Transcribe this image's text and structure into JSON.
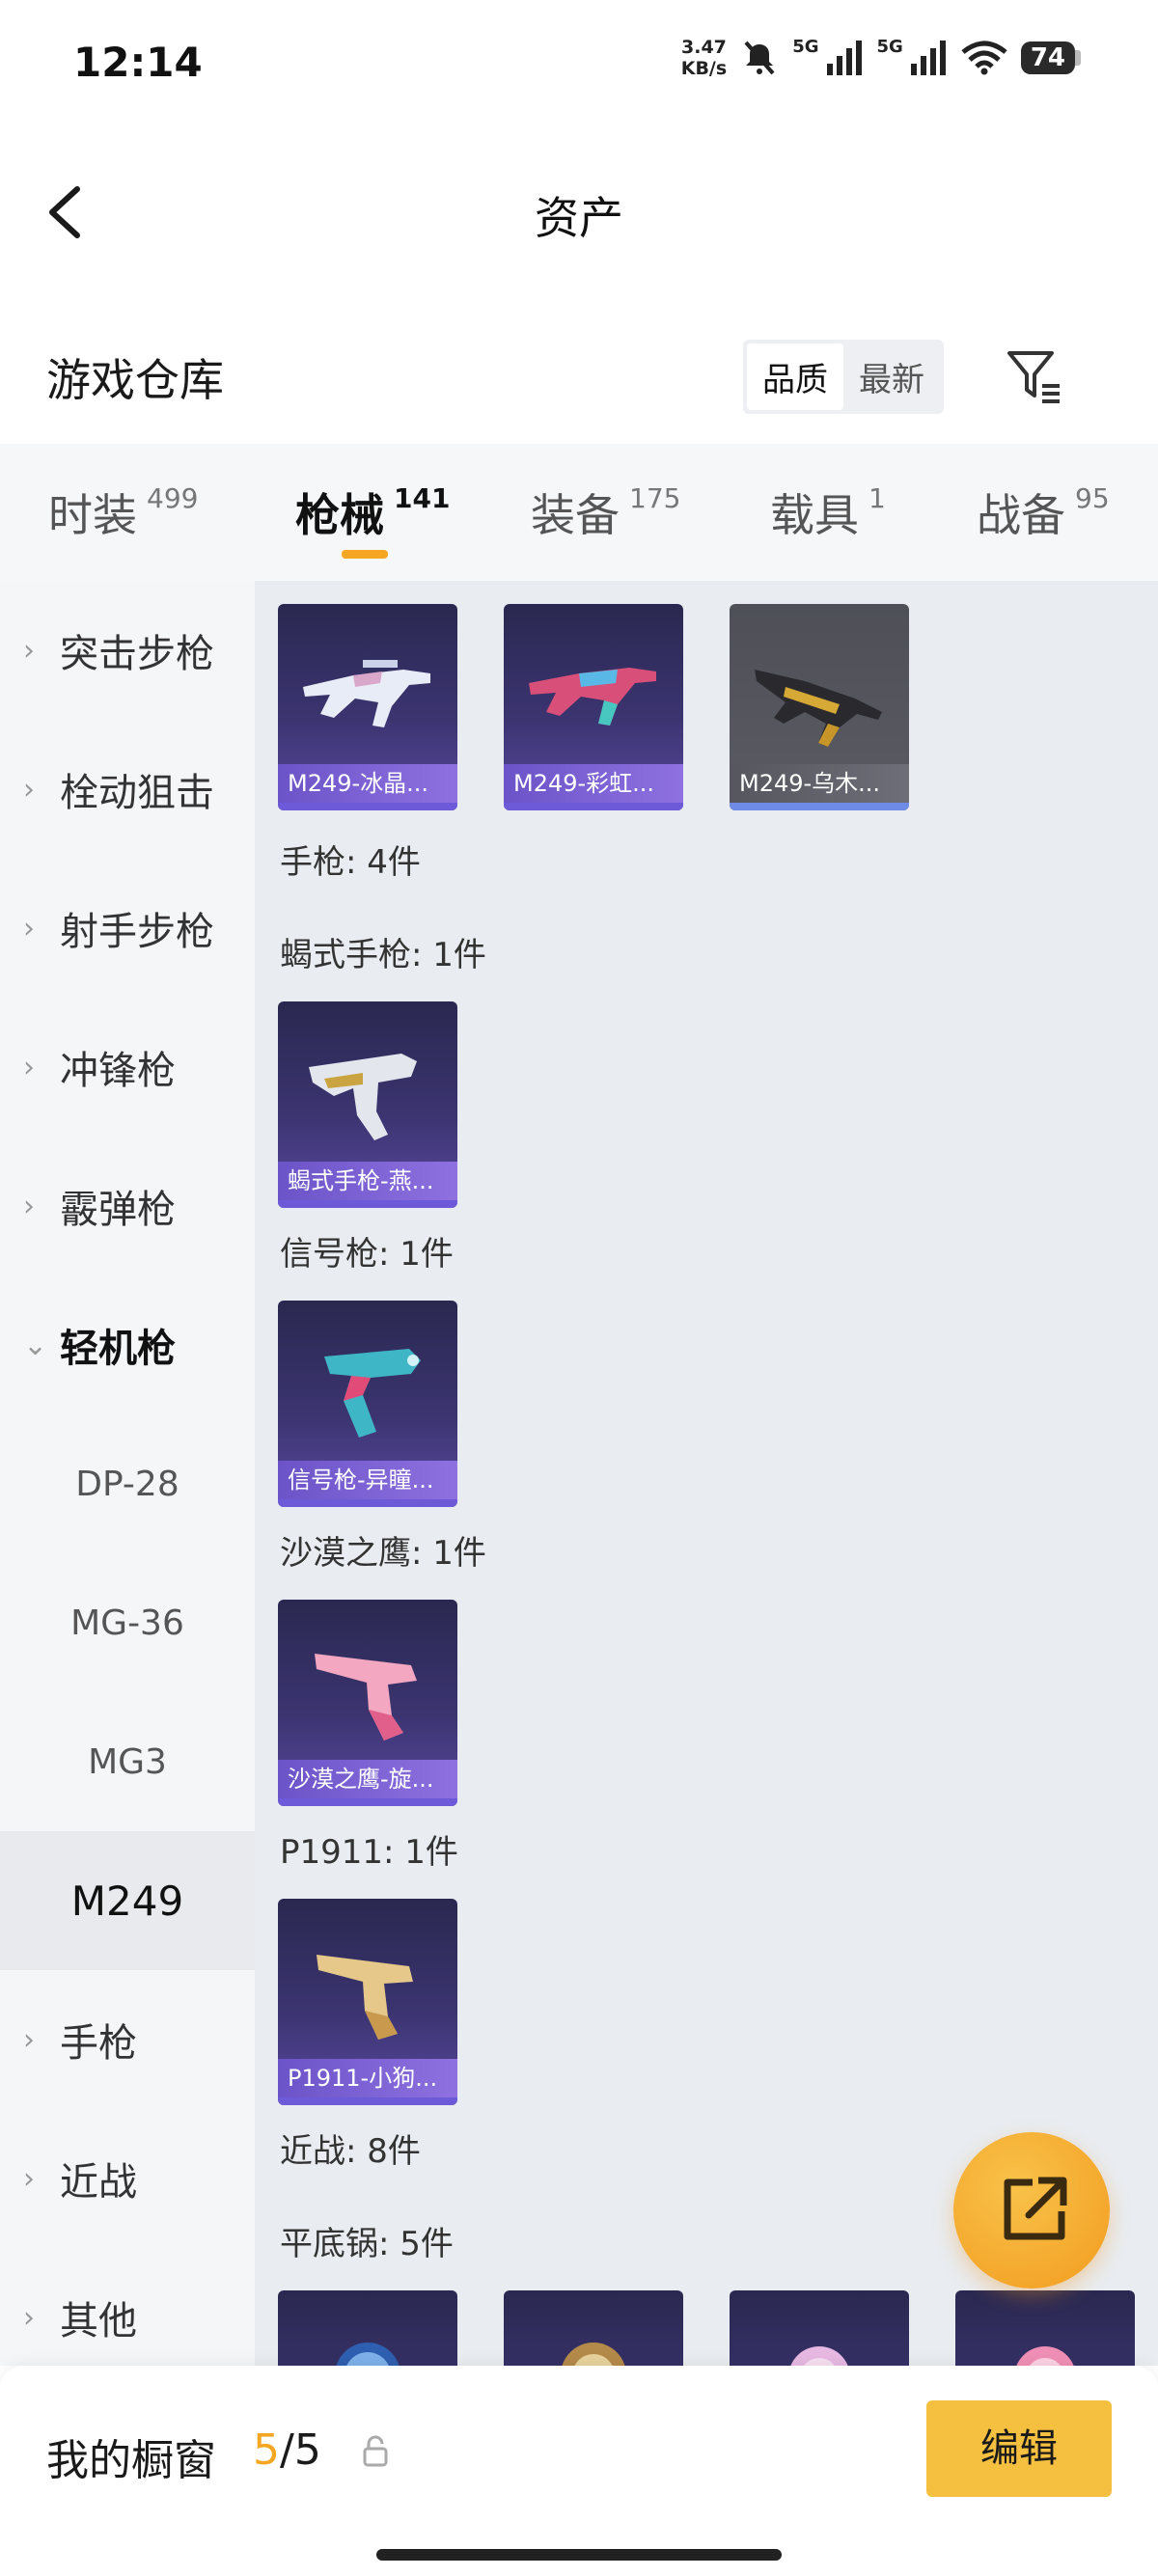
{
  "status": {
    "time": "12:14",
    "net_speed_value": "3.47",
    "net_speed_unit": "KB/s",
    "sim1": "5G",
    "sim2": "5G",
    "battery": "74"
  },
  "header": {
    "title": "资产"
  },
  "warehouse": {
    "title": "游戏仓库",
    "sort_options": [
      "品质",
      "最新"
    ],
    "active_sort": "品质"
  },
  "tabs": [
    {
      "label": "时装",
      "count": "499"
    },
    {
      "label": "枪械",
      "count": "141"
    },
    {
      "label": "装备",
      "count": "175"
    },
    {
      "label": "载具",
      "count": "1"
    },
    {
      "label": "战备",
      "count": "95"
    }
  ],
  "active_tab": "枪械",
  "sidebar": {
    "categories": [
      {
        "label": "突击步枪",
        "chevron": "›"
      },
      {
        "label": "栓动狙击",
        "chevron": "›"
      },
      {
        "label": "射手步枪",
        "chevron": "›"
      },
      {
        "label": "冲锋枪",
        "chevron": "›"
      },
      {
        "label": "霰弹枪",
        "chevron": "›"
      },
      {
        "label": "轻机枪",
        "chevron": "⌄"
      }
    ],
    "sub_items": [
      "DP-28",
      "MG-36",
      "MG3",
      "M249"
    ],
    "selected_sub": "M249",
    "categories_after": [
      {
        "label": "手枪",
        "chevron": "›"
      },
      {
        "label": "近战",
        "chevron": "›"
      },
      {
        "label": "其他",
        "chevron": "›"
      }
    ]
  },
  "content": {
    "m249_cards": [
      "M249-冰晶...",
      "M249-彩虹...",
      "M249-乌木..."
    ],
    "pistol_total": "手枪: 4件",
    "groups": [
      {
        "label": "蝎式手枪: 1件",
        "card": "蝎式手枪-燕..."
      },
      {
        "label": "信号枪: 1件",
        "card": "信号枪-异瞳..."
      },
      {
        "label": "沙漠之鹰: 1件",
        "card": "沙漠之鹰-旋..."
      },
      {
        "label": "P1911: 1件",
        "card": "P1911-小狗..."
      }
    ],
    "melee_total": "近战: 8件",
    "pan_label": "平底锅: 5件"
  },
  "showcase": {
    "title": "我的橱窗",
    "current": "5",
    "total": "/5",
    "edit_label": "编辑"
  },
  "icons": {
    "back": "chevron-left-icon",
    "filter": "filter-icon",
    "share": "external-link-icon",
    "lock": "lock-icon"
  },
  "colors": {
    "accent": "#f5a623",
    "edit_button": "#f5c040",
    "card_purple": "#3b3470",
    "card_label": "#7a62d4"
  }
}
